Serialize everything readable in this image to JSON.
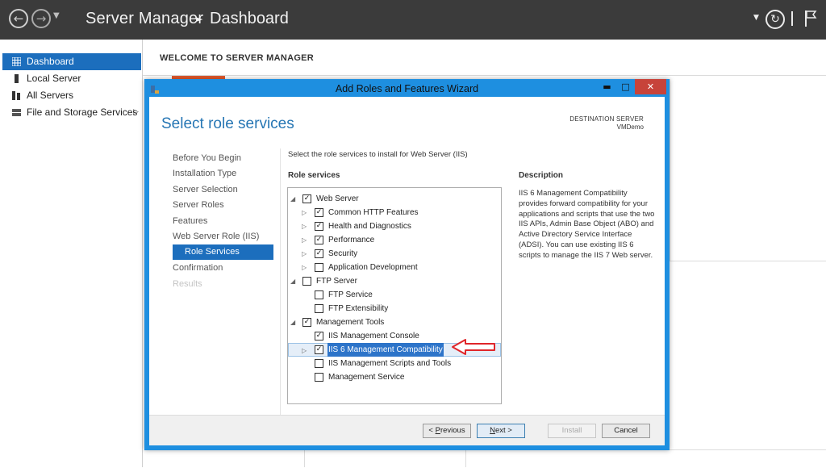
{
  "titlebar": {
    "app_name": "Server Manager",
    "page": "Dashboard",
    "back_icon": "arrow-left-icon",
    "forward_icon": "arrow-right-icon"
  },
  "sidebar": {
    "items": [
      {
        "label": "Dashboard",
        "icon": "dashboard-grid-icon",
        "selected": true
      },
      {
        "label": "Local Server",
        "icon": "server-icon"
      },
      {
        "label": "All Servers",
        "icon": "servers-icon"
      },
      {
        "label": "File and Storage Services",
        "icon": "storage-icon",
        "has_submenu": true
      }
    ]
  },
  "main": {
    "welcome": "WELCOME TO SERVER MANAGER"
  },
  "wizard": {
    "title": "Add Roles and Features Wizard",
    "heading": "Select role services",
    "destination_label": "DESTINATION SERVER",
    "destination_value": "VMDemo",
    "steps": [
      {
        "label": "Before You Begin"
      },
      {
        "label": "Installation Type"
      },
      {
        "label": "Server Selection"
      },
      {
        "label": "Server Roles"
      },
      {
        "label": "Features"
      },
      {
        "label": "Web Server Role (IIS)"
      },
      {
        "label": "Role Services",
        "active": true
      },
      {
        "label": "Confirmation"
      },
      {
        "label": "Results",
        "disabled": true
      }
    ],
    "instruction": "Select the role services to install for Web Server (IIS)",
    "role_services_label": "Role services",
    "description_label": "Description",
    "description_text": "IIS 6 Management Compatibility provides forward compatibility for your applications and scripts that use the two IIS APIs, Admin Base Object (ABO) and Active Directory Service Interface (ADSI). You can use existing IIS 6 scripts to manage the IIS 7 Web server.",
    "tree": [
      {
        "label": "Web Server",
        "checked": true,
        "expander": "expanded",
        "level": 0
      },
      {
        "label": "Common HTTP Features",
        "checked": true,
        "expander": "collapsed",
        "level": 1
      },
      {
        "label": "Health and Diagnostics",
        "checked": true,
        "expander": "collapsed",
        "level": 1
      },
      {
        "label": "Performance",
        "checked": true,
        "expander": "collapsed",
        "level": 1
      },
      {
        "label": "Security",
        "checked": true,
        "expander": "collapsed",
        "level": 1
      },
      {
        "label": "Application Development",
        "checked": false,
        "expander": "collapsed",
        "level": 1
      },
      {
        "label": "FTP Server",
        "checked": false,
        "expander": "expanded",
        "level": 0
      },
      {
        "label": "FTP Service",
        "checked": false,
        "level": 1
      },
      {
        "label": "FTP Extensibility",
        "checked": false,
        "level": 1
      },
      {
        "label": "Management Tools",
        "checked": true,
        "expander": "expanded",
        "level": 0
      },
      {
        "label": "IIS Management Console",
        "checked": true,
        "level": 1
      },
      {
        "label": "IIS 6 Management Compatibility",
        "checked": true,
        "expander": "collapsed",
        "level": 1,
        "selected": true
      },
      {
        "label": "IIS Management Scripts and Tools",
        "checked": false,
        "level": 1
      },
      {
        "label": "Management Service",
        "checked": false,
        "level": 1
      }
    ],
    "buttons": {
      "previous_prefix": "< ",
      "previous_key": "P",
      "previous_rest": "revious",
      "next_key": "N",
      "next_rest": "ext >",
      "install": "Install",
      "cancel": "Cancel"
    },
    "colors": {
      "frame": "#1e8fe0",
      "selection": "#1c6ebd",
      "annotation": "#e0262a"
    }
  }
}
